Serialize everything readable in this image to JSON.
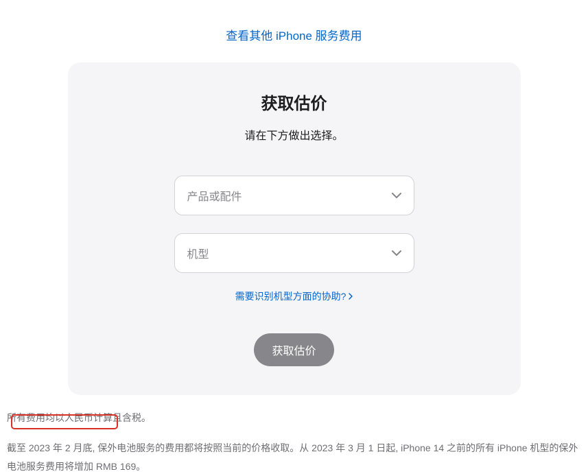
{
  "topLink": "查看其他 iPhone 服务费用",
  "card": {
    "title": "获取估价",
    "subtitle": "请在下方做出选择。",
    "select1Placeholder": "产品或配件",
    "select2Placeholder": "机型",
    "helpLink": "需要识别机型方面的协助?",
    "submitLabel": "获取估价"
  },
  "footer": {
    "line1": "所有费用均以人民币计算且含税。",
    "line2": "截至 2023 年 2 月底, 保外电池服务的费用都将按照当前的价格收取。从 2023 年 3 月 1 日起, iPhone 14 之前的所有 iPhone 机型的保外电池服务费用将增加 RMB 169。"
  }
}
